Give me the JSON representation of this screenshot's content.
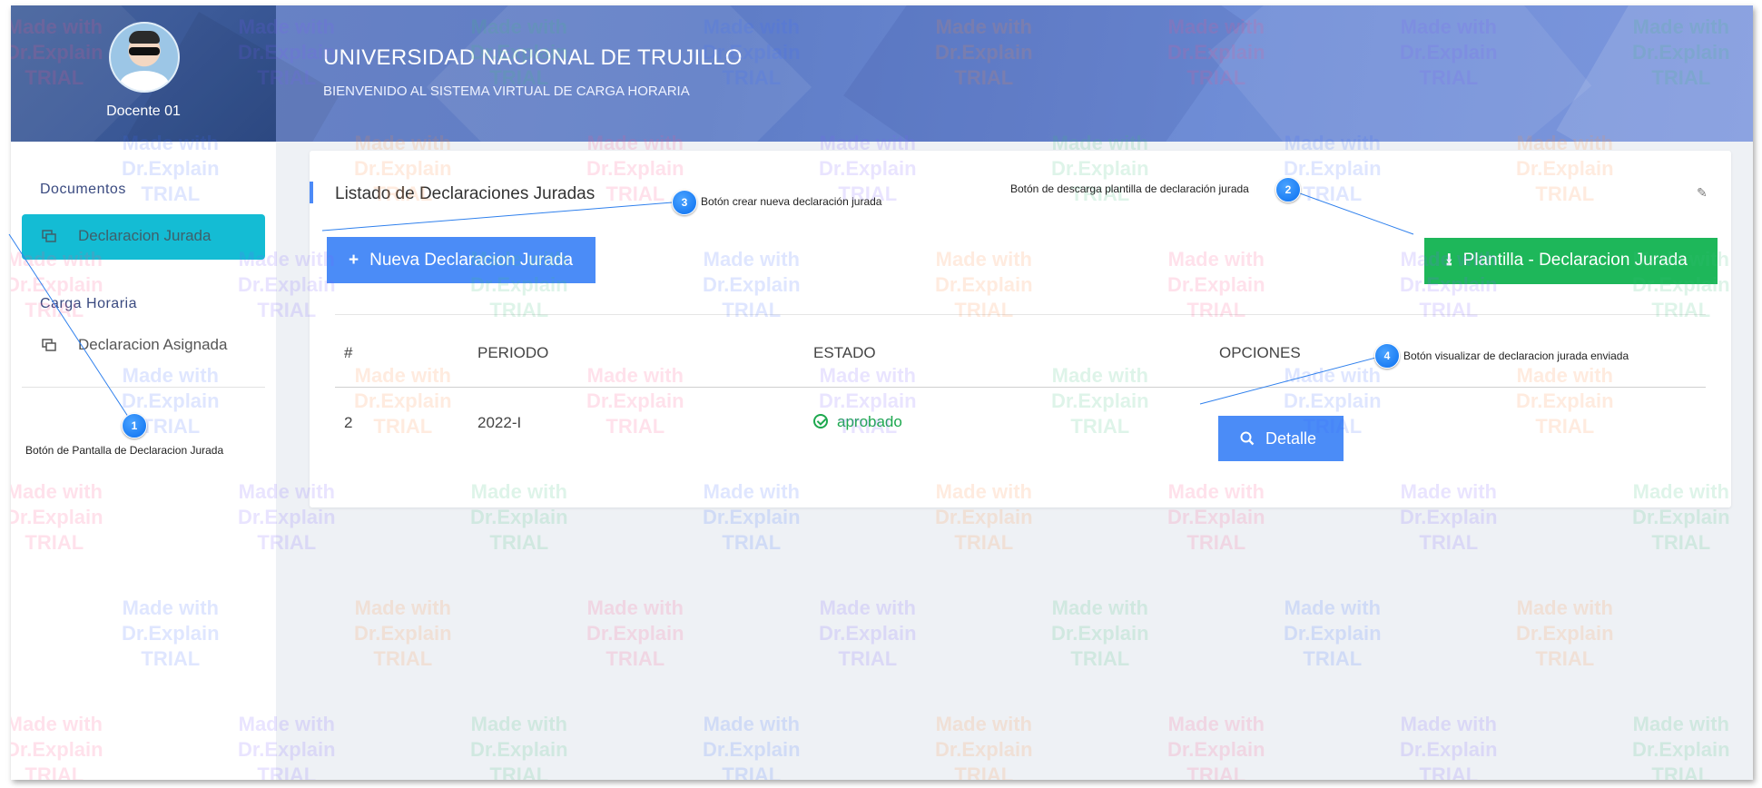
{
  "header": {
    "user_name": "Docente 01",
    "title": "UNIVERSIDAD NACIONAL DE TRUJILLO",
    "subtitle": "BIENVENIDO AL SISTEMA VIRTUAL DE CARGA HORARIA"
  },
  "sidebar": {
    "sections": [
      {
        "title": "Documentos",
        "items": [
          {
            "label": "Declaracion Jurada",
            "active": true,
            "icon": "copy-icon"
          }
        ]
      },
      {
        "title": "Carga Horaria",
        "items": [
          {
            "label": "Declaracion Asignada",
            "active": false,
            "icon": "copy-icon"
          }
        ]
      }
    ]
  },
  "main": {
    "card_title": "Listado de Declaraciones Juradas",
    "new_button_label": "Nueva Declaracion Jurada",
    "template_button_label": "Plantilla - Declaracion Jurada",
    "table": {
      "columns": [
        "#",
        "PERIODO",
        "ESTADO",
        "OPCIONES"
      ],
      "rows": [
        {
          "num": "2",
          "periodo": "2022-I",
          "estado": "aprobado",
          "action": "Detalle"
        }
      ]
    }
  },
  "callouts": [
    {
      "num": "1",
      "text": "Botón de Pantalla de Declaracion Jurada"
    },
    {
      "num": "2",
      "text": "Botón de descarga plantilla de declaración jurada"
    },
    {
      "num": "3",
      "text": "Botón crear nueva declaración jurada"
    },
    {
      "num": "4",
      "text": "Botón visualizar de declaracion jurada enviada"
    }
  ],
  "watermark": {
    "line1": "Made with",
    "line2": "Dr.Explain",
    "line3": "TRIAL"
  },
  "colors": {
    "active_item": "#14bcd4",
    "primary_button": "#4b8cf7",
    "success_button": "#1eb75a",
    "status_approved": "#1da84e",
    "callout_badge": "#0a6ff0"
  }
}
